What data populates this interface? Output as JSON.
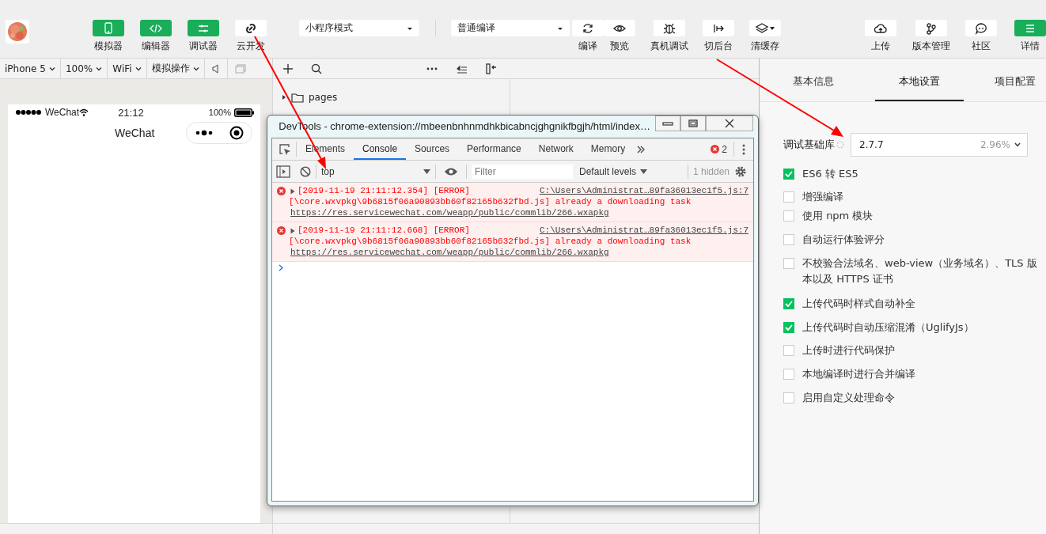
{
  "toolbar": {
    "left_buttons": [
      {
        "label": "模拟器",
        "kind": "primary"
      },
      {
        "label": "编辑器",
        "kind": "primary"
      },
      {
        "label": "调试器",
        "kind": "primary"
      },
      {
        "label": "云开发",
        "kind": "plain"
      }
    ],
    "mode_select": {
      "value": "小程序模式"
    },
    "compile_select": {
      "value": "普通编译"
    },
    "right_buttons": [
      {
        "label": "编译",
        "kind": "plain"
      },
      {
        "label": "预览",
        "kind": "plain"
      },
      {
        "label": "真机调试",
        "kind": "plain"
      },
      {
        "label": "切后台",
        "kind": "plain"
      },
      {
        "label": "清缓存",
        "kind": "plain"
      },
      {
        "label": "上传",
        "kind": "plain"
      },
      {
        "label": "版本管理",
        "kind": "plain"
      },
      {
        "label": "社区",
        "kind": "plain"
      },
      {
        "label": "详情",
        "kind": "primary"
      }
    ]
  },
  "simulator": {
    "options": [
      "iPhone 5",
      "100%",
      "WiFi",
      "模拟操作"
    ],
    "phone": {
      "carrier": "WeChat",
      "time": "21:12",
      "battery": "100%",
      "title": "WeChat"
    }
  },
  "file_tree": [
    {
      "name": "pages",
      "expanded": false
    }
  ],
  "settings": {
    "tabs": [
      {
        "label": "基本信息",
        "selected": false
      },
      {
        "label": "本地设置",
        "selected": true
      },
      {
        "label": "项目配置",
        "selected": false
      }
    ],
    "library": {
      "label": "调试基础库",
      "version": "2.7.7",
      "usage": "2.96%"
    },
    "options": [
      {
        "label": "ES6 转 ES5",
        "checked": true
      },
      {
        "label": "增强编译",
        "checked": false
      },
      {
        "label": "使用 npm 模块",
        "checked": false
      },
      {
        "label": "自动运行体验评分",
        "checked": false
      },
      {
        "label": "不校验合法域名、web-view（业务域名）、TLS 版本以及 HTTPS 证书",
        "checked": false
      },
      {
        "label": "上传代码时样式自动补全",
        "checked": true
      },
      {
        "label": "上传代码时自动压缩混淆（UglifyJs）",
        "checked": true
      },
      {
        "label": "上传时进行代码保护",
        "checked": false
      },
      {
        "label": "本地编译时进行合并编译",
        "checked": false
      },
      {
        "label": "启用自定义处理命令",
        "checked": false
      }
    ]
  },
  "devtools": {
    "title": "DevTools - chrome-extension://mbeenbnhnmdhkbicabncjghgnikfbgjh/html/index…",
    "tabs": [
      {
        "label": "Elements",
        "selected": false
      },
      {
        "label": "Console",
        "selected": true
      },
      {
        "label": "Sources",
        "selected": false
      },
      {
        "label": "Performance",
        "selected": false
      },
      {
        "label": "Network",
        "selected": false
      },
      {
        "label": "Memory",
        "selected": false
      }
    ],
    "error_count": "2",
    "context": "top",
    "filter_placeholder": "Filter",
    "levels": "Default levels",
    "hidden": "1 hidden",
    "messages": [
      {
        "timestamp": "[2019-11-19 21:11:12.354] [ERROR]",
        "source": "C:\\Users\\Administrat…89fa36013ec1f5.js:7",
        "text": "[\\core.wxvpkg\\9b6815f06a90893bb60f82165b632fbd.js] already a downloading task",
        "link": "https://res.servicewechat.com/weapp/public/commlib/266.wxapkg"
      },
      {
        "timestamp": "[2019-11-19 21:11:12.668] [ERROR]",
        "source": "C:\\Users\\Administrat…89fa36013ec1f5.js:7",
        "text": "[\\core.wxvpkg\\9b6815f06a90893bb60f82165b632fbd.js] already a downloading task",
        "link": "https://res.servicewechat.com/weapp/public/commlib/266.wxapkg"
      }
    ]
  }
}
